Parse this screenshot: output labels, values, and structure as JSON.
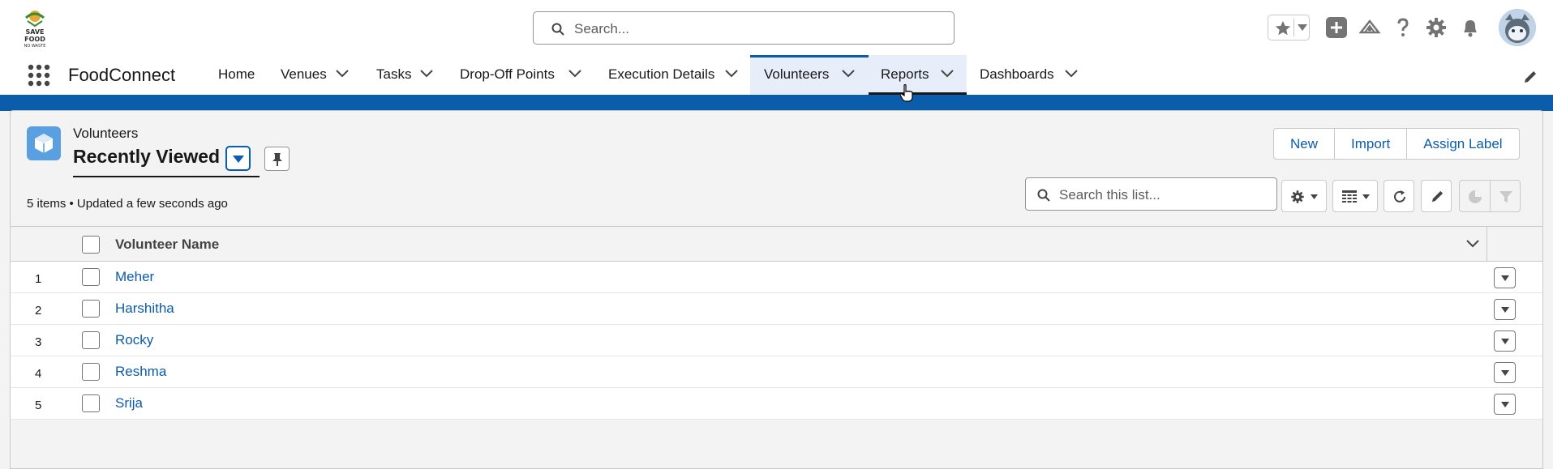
{
  "header": {
    "logo_text": "SAVE FOOD NO WASTE",
    "search_placeholder": "Search..."
  },
  "nav": {
    "app_name": "FoodConnect",
    "items": [
      {
        "label": "Home"
      },
      {
        "label": "Venues"
      },
      {
        "label": "Tasks"
      },
      {
        "label": "Drop-Off Points"
      },
      {
        "label": "Execution Details"
      },
      {
        "label": "Volunteers"
      },
      {
        "label": "Reports"
      },
      {
        "label": "Dashboards"
      }
    ],
    "active": "Volunteers"
  },
  "list_view": {
    "object_label": "Volunteers",
    "title": "Recently Viewed",
    "actions": {
      "new": "New",
      "import": "Import",
      "assign_label": "Assign Label"
    },
    "meta": "5 items • Updated a few seconds ago",
    "search_placeholder": "Search this list...",
    "column_header": "Volunteer Name",
    "rows": [
      {
        "num": "1",
        "name": "Meher"
      },
      {
        "num": "2",
        "name": "Harshitha"
      },
      {
        "num": "3",
        "name": "Rocky"
      },
      {
        "num": "4",
        "name": "Reshma"
      },
      {
        "num": "5",
        "name": "Srija"
      }
    ]
  },
  "colors": {
    "brand_blue": "#0b5cab",
    "object_icon": "#5a9fe0"
  }
}
